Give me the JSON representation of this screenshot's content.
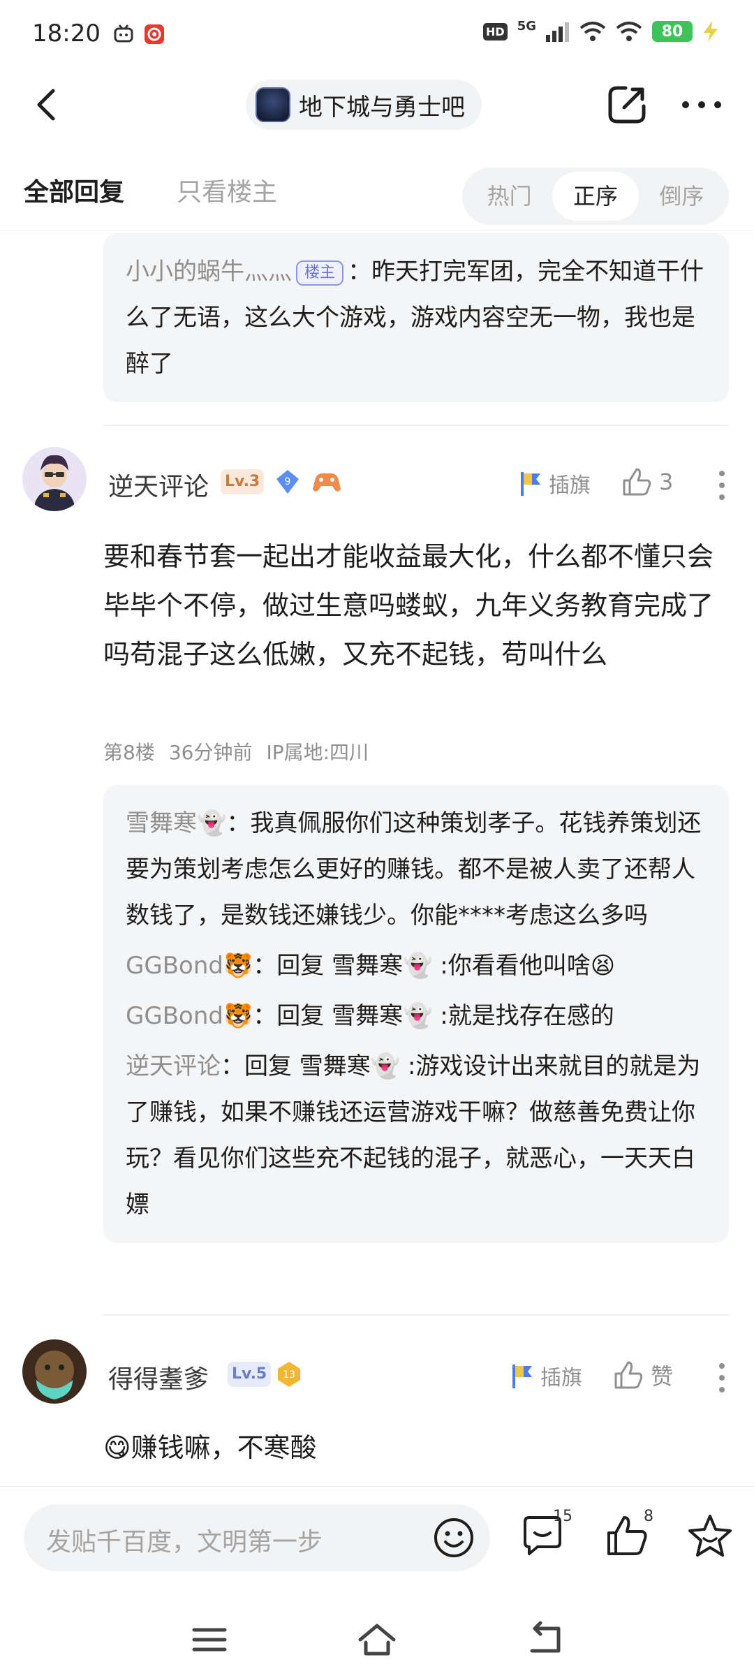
{
  "status_bar": {
    "time": "18:20",
    "hd": "HD",
    "network": "5G",
    "battery": "80"
  },
  "header": {
    "forum_name": "地下城与勇士吧"
  },
  "filter": {
    "all_replies": "全部回复",
    "op_only": "只看楼主",
    "sort_options": [
      "热门",
      "正序",
      "倒序"
    ],
    "sort_selected": "正序"
  },
  "top_reply": {
    "name": "小小的蜗牛灬灬",
    "op_badge": "楼主",
    "colon": "：",
    "text": "昨天打完军团，完全不知道干什么了无语，这么大个游戏，游戏内容空无一物，我也是醉了"
  },
  "post_8": {
    "user": "逆天评论",
    "level": "Lv.3",
    "badge_number": "9",
    "flag_label": "插旗",
    "like_count": "3",
    "body": "要和春节套一起出才能收益最大化，什么都不懂只会毕毕个不停，做过生意吗蝼蚁，九年义务教育完成了吗苟混子这么低嫩，又充不起钱，苟叫什么",
    "floor": "第8楼",
    "time": "36分钟前",
    "ip": "IP属地:四川",
    "replies": [
      {
        "name": "雪舞寒👻",
        "colon": "：",
        "text": "我真佩服你们这种策划孝子。花钱养策划还要为策划考虑怎么更好的赚钱。都不是被人卖了还帮人数钱了，是数钱还嫌钱少。你能****考虑这么多吗"
      },
      {
        "name": "GGBond🐯",
        "colon": "：",
        "text": "回复 雪舞寒👻 :你看看他叫啥😫"
      },
      {
        "name": "GGBond🐯",
        "colon": "：",
        "text": "回复 雪舞寒👻 :就是找存在感的"
      },
      {
        "name": "逆天评论",
        "colon": "：",
        "text": "回复 雪舞寒👻 :游戏设计出来就目的就是为了赚钱，如果不赚钱还运营游戏干嘛？做慈善免费让你玩？看见你们这些充不起钱的混子，就恶心，一天天白嫖"
      }
    ]
  },
  "post_9": {
    "user": "得得耋爹",
    "level": "Lv.5",
    "badge_number": "13",
    "flag_label": "插旗",
    "like_label": "赞",
    "emoji": "😋",
    "body": "赚钱嘛，不寒酸"
  },
  "bottom_bar": {
    "placeholder": "发贴千百度，文明第一步",
    "comment_count": "15",
    "like_count": "8"
  },
  "colors": {
    "accent_blue": "#4a7cf0",
    "op_badge": "#6a72d6",
    "battery_green": "#3cc45a",
    "text_gray": "#8f8f8f"
  },
  "icons": [
    "back-icon",
    "share-icon",
    "more-icon",
    "flag-icon",
    "thumb-up-icon",
    "emoji-icon",
    "comment-icon",
    "star-icon",
    "menu-icon",
    "home-icon",
    "return-icon"
  ]
}
